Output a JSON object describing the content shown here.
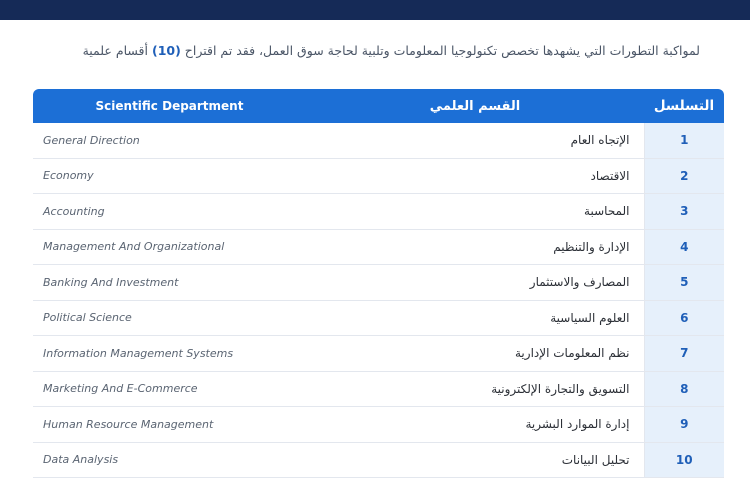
{
  "intro": {
    "text_before": "لمواكبة التطورات التي يشهدها تخصص تكنولوجيا المعلومات وتلبية لحاجة سوق العمل، فقد تم اقتراح ",
    "count": "(10)",
    "text_after": " أقسام علمية"
  },
  "table": {
    "headers": {
      "sequence": "التسلسل",
      "arabic": "القسم العلمي",
      "english": "Scientific Department"
    },
    "rows": [
      {
        "seq": "1",
        "ar": "الإتجاه العام",
        "en": "General Direction"
      },
      {
        "seq": "2",
        "ar": "الاقتصاد",
        "en": "Economy"
      },
      {
        "seq": "3",
        "ar": "المحاسبة",
        "en": "Accounting"
      },
      {
        "seq": "4",
        "ar": "الإدارة والتنظيم",
        "en": "Management And Organizational"
      },
      {
        "seq": "5",
        "ar": "المصارف والاستثمار",
        "en": "Banking And Investment"
      },
      {
        "seq": "6",
        "ar": "العلوم السياسية",
        "en": "Political Science"
      },
      {
        "seq": "7",
        "ar": "نظم المعلومات الإدارية",
        "en": "Information Management Systems"
      },
      {
        "seq": "8",
        "ar": "التسويق والتجارة الإلكترونية",
        "en": "Marketing And E-Commerce"
      },
      {
        "seq": "9",
        "ar": "إدارة الموارد البشرية",
        "en": "Human Resource Management"
      },
      {
        "seq": "10",
        "ar": "تحليل البيانات",
        "en": "Data Analysis"
      }
    ]
  }
}
